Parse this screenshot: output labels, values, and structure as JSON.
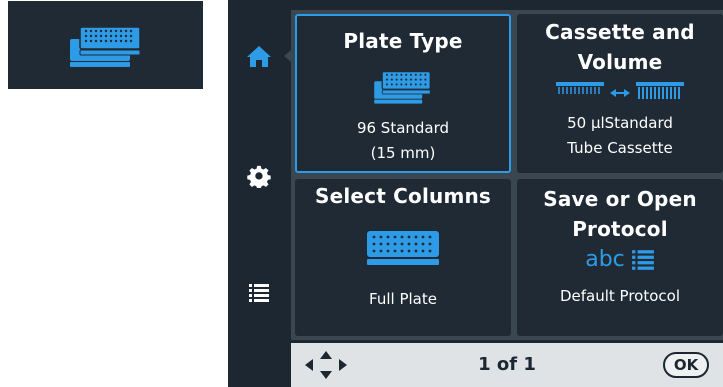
{
  "thumbnail": {
    "icon": "stacked-plates-icon"
  },
  "sidebar": {
    "items": [
      {
        "icon": "home-icon",
        "active": true
      },
      {
        "icon": "gear-icon",
        "active": false
      },
      {
        "icon": "list-icon",
        "active": false
      }
    ]
  },
  "tiles": {
    "plate_type": {
      "title": "Plate Type",
      "line1": "96 Standard",
      "line2": "(15 mm)",
      "icon": "stacked-plates-icon"
    },
    "cassette": {
      "title_line1": "Cassette and",
      "title_line2": "Volume",
      "line1": "50 µlStandard",
      "line2": "Tube Cassette",
      "icon": "cassette-volume-icon"
    },
    "select_columns": {
      "title": "Select Columns",
      "line1": "Full Plate",
      "icon": "plate-icon"
    },
    "protocol": {
      "title_line1": "Save or Open",
      "title_line2": "Protocol",
      "icon_text": "abc",
      "line1": "Default Protocol",
      "icon": "protocol-list-icon"
    }
  },
  "footer": {
    "page_indicator": "1 of 1",
    "ok_label": "OK",
    "nav_icon": "dpad-arrows-icon"
  },
  "colors": {
    "accent": "#2e9be6",
    "panel": "#1f2a34",
    "background": "#1c2731",
    "footer": "#dfe3e6"
  }
}
